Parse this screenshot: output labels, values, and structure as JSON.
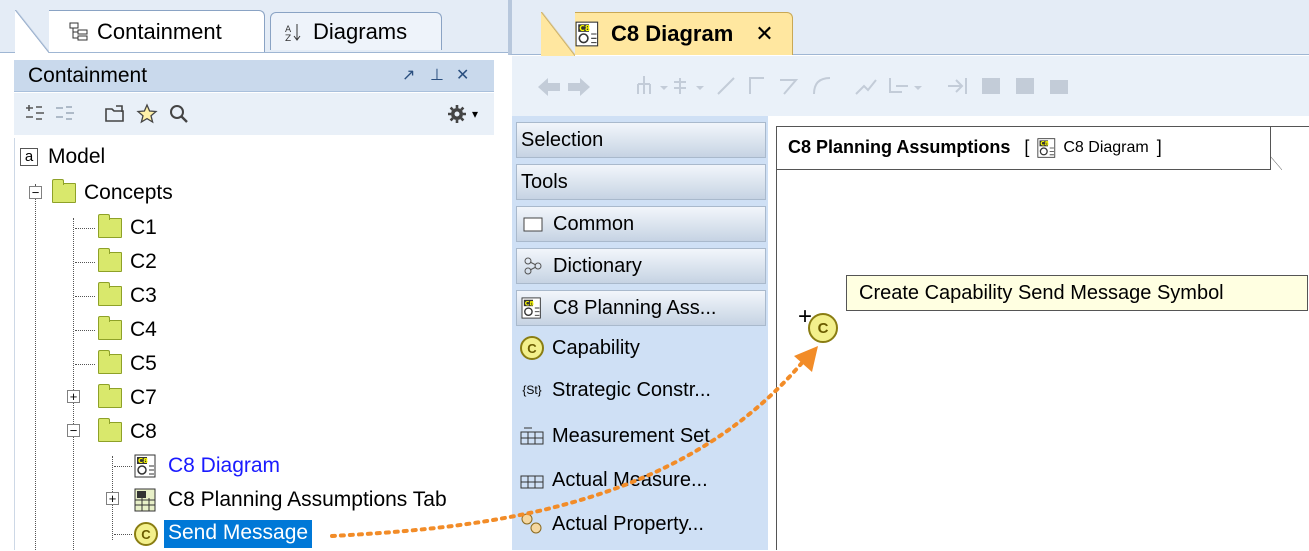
{
  "left_tabs": {
    "containment": "Containment",
    "diagrams": "Diagrams"
  },
  "containment_panel": {
    "title": "Containment",
    "header_buttons": [
      "↗",
      "⊥",
      "✕"
    ],
    "toolbar_icons": [
      "collapse-all-icon",
      "expand-all-icon",
      "open-folder-icon",
      "favorites-star-icon",
      "search-icon",
      "settings-gear-icon"
    ]
  },
  "tree": {
    "model": "Model",
    "concepts": "Concepts",
    "c1": "C1",
    "c2": "C2",
    "c3": "C3",
    "c4": "C4",
    "c5": "C5",
    "c7": "C7",
    "c8": "C8",
    "c8_diagram": "C8 Diagram",
    "c8_table": "C8 Planning Assumptions Tab",
    "send_message": "Send Message"
  },
  "diagram_tab": {
    "title": "C8 Diagram",
    "close": "✕"
  },
  "palette": {
    "selection": "Selection",
    "tools": "Tools",
    "common": "Common",
    "dictionary": "Dictionary",
    "c8_group": "C8 Planning Ass...",
    "capability": "Capability",
    "strategic": "Strategic Constr...",
    "measurement_set": "Measurement Set",
    "actual_measure": "Actual Measure...",
    "actual_property": "Actual Property..."
  },
  "frame": {
    "title": "C8 Planning Assumptions",
    "open_bracket": "[",
    "diagram_ref": "C8 Diagram",
    "close_bracket": "]"
  },
  "tooltip": "Create Capability Send Message Symbol",
  "colors": {
    "selection_bg": "#0078d7",
    "tab_active": "#ffe7a0",
    "palette_bg": "#cfe0f5",
    "drag_arrow": "#f28c28",
    "tooltip_bg": "#ffffe1",
    "link_text": "#1a1aff"
  }
}
